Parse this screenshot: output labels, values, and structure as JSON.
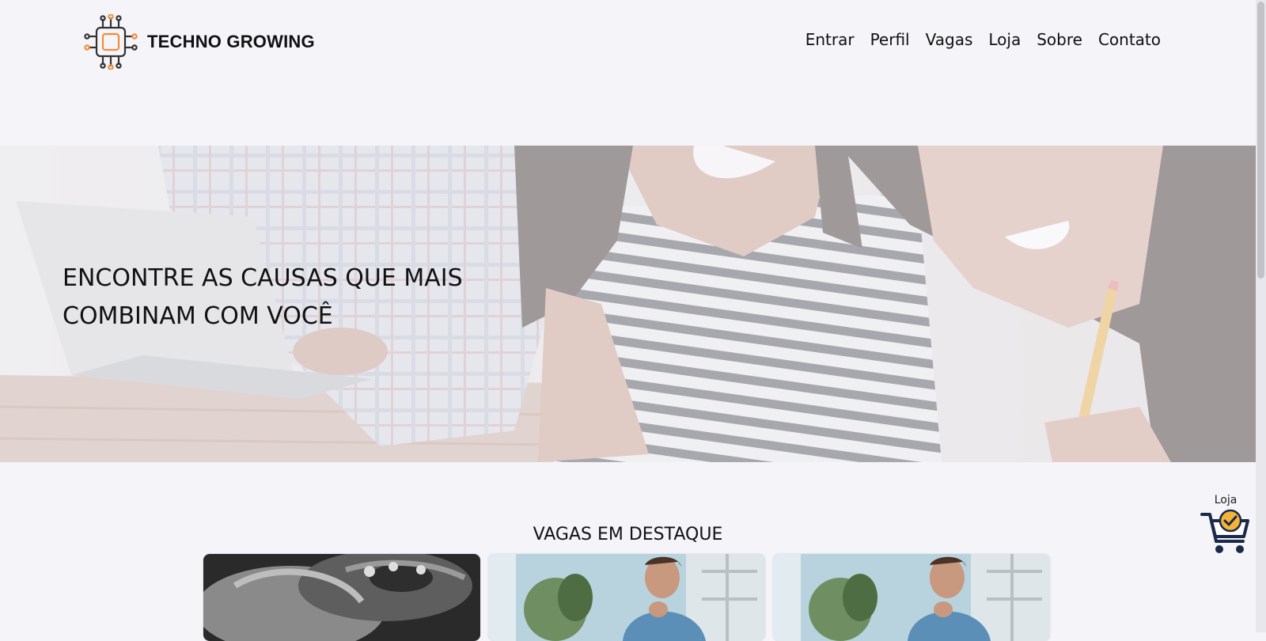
{
  "brand": {
    "name": "TECHNO GROWING",
    "logo_icon": "circuit-chip-icon",
    "accent": "#f28c38"
  },
  "nav": {
    "items": [
      {
        "label": "Entrar"
      },
      {
        "label": "Perfil"
      },
      {
        "label": "Vagas"
      },
      {
        "label": "Loja"
      },
      {
        "label": "Sobre"
      },
      {
        "label": "Contato"
      }
    ]
  },
  "hero": {
    "title": "ENCONTRE AS CAUSAS QUE MAIS COMBINAM COM VOCÊ"
  },
  "featured": {
    "title": "VAGAS EM DESTAQUE",
    "cards": [
      {
        "image": "helping-hands-photo"
      },
      {
        "image": "man-thinking-photo"
      },
      {
        "image": "man-thinking-photo"
      }
    ]
  },
  "shop_widget": {
    "label": "Loja",
    "icon": "shopping-cart-check-icon",
    "check_color": "#f6b436",
    "cart_color": "#1c2a4a"
  }
}
